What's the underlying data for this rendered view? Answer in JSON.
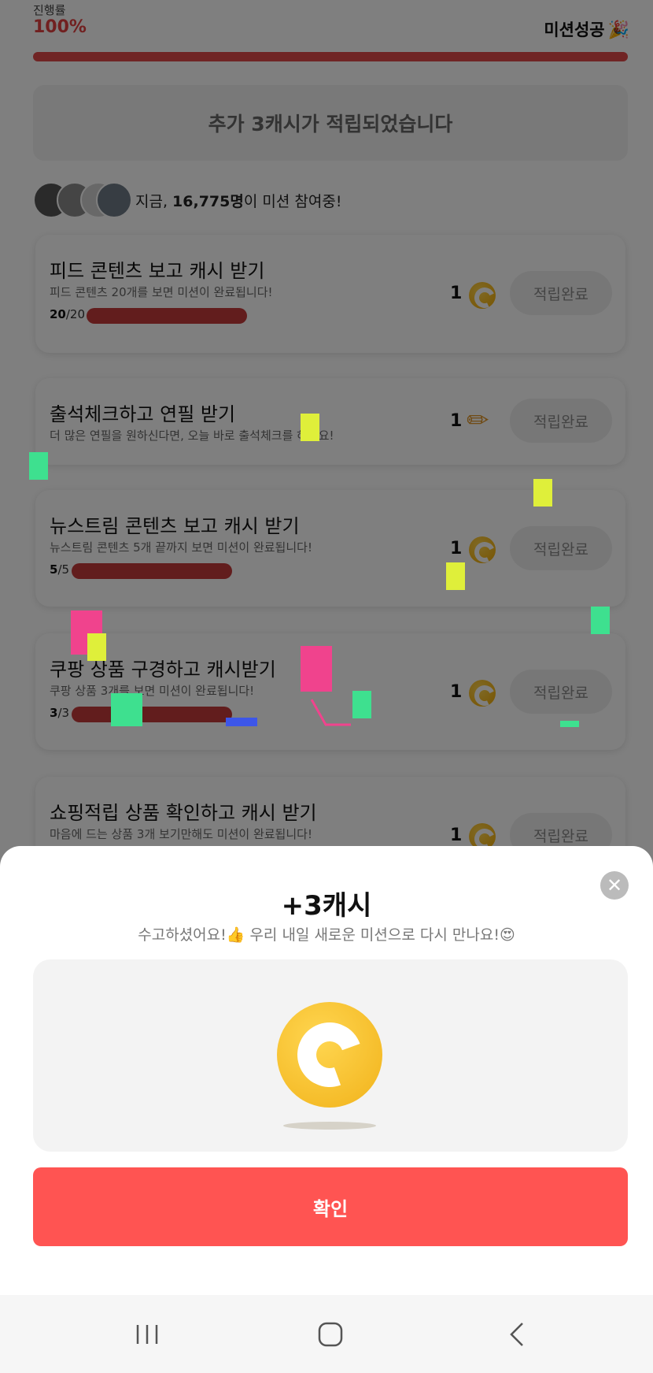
{
  "progress": {
    "label": "진행률",
    "value": "100%",
    "status": "미션성공",
    "status_emoji": "🎉",
    "fill": 1.0
  },
  "reward_banner": "추가 3캐시가 적립되었습니다",
  "participants": {
    "prefix": "지금, ",
    "count": "16,775명",
    "suffix": "이 미션 참여중!"
  },
  "missions": [
    {
      "title": "피드 콘텐츠 보고 캐시 받기",
      "desc": "피드 콘텐츠 20개를 보면 미션이 완료됩니다!",
      "done": "20",
      "total": "/20",
      "reward": "1",
      "reward_icon": "coin-icon",
      "button": "적립완료",
      "fill": 1.0
    },
    {
      "title": "출석체크하고 연필 받기",
      "desc": "더 많은 연필을 원하신다면, 오늘 바로 출석체크를 하세요!",
      "reward": "1",
      "reward_icon": "pencil-icon",
      "button": "적립완료"
    },
    {
      "title": "뉴스트림 콘텐츠 보고 캐시 받기",
      "desc": "뉴스트림 콘텐츠 5개 끝까지 보면 미션이 완료됩니다!",
      "done": "5",
      "total": "/5",
      "reward": "1",
      "reward_icon": "coin-icon",
      "button": "적립완료",
      "fill": 1.0
    },
    {
      "title": "쿠팡 상품 구경하고 캐시받기",
      "desc": "쿠팡 상품 3개를 보면 미션이 완료됩니다!",
      "done": "3",
      "total": "/3",
      "reward": "1",
      "reward_icon": "coin-icon",
      "button": "적립완료",
      "fill": 1.0
    },
    {
      "title": "쇼핑적립 상품 확인하고 캐시 받기",
      "desc": "마음에 드는 상품 3개 보기만해도 미션이 완료됩니다!",
      "reward": "1",
      "reward_icon": "coin-icon",
      "button": "적립완료"
    }
  ],
  "sheet": {
    "title": "+3캐시",
    "subtitle": "수고하셨어요!👍 우리 내일 새로운 미션으로 다시 만나요!😍",
    "confirm": "확인",
    "close_icon": "close-icon"
  },
  "colors": {
    "accent": "#ff5452",
    "progress": "#e04848",
    "coin": "#f1b21a"
  }
}
